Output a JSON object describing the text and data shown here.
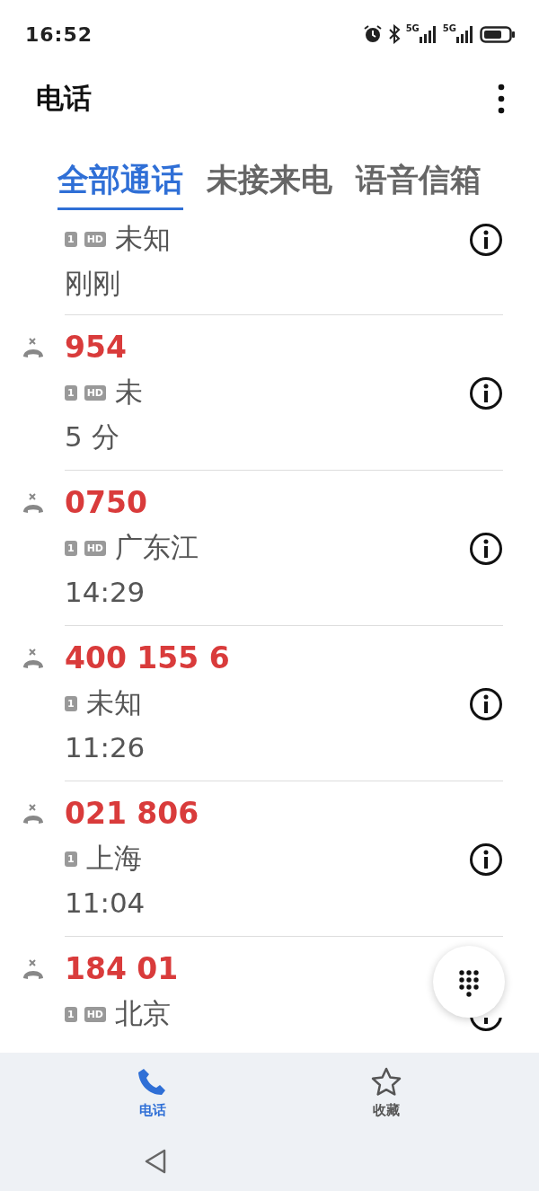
{
  "status_bar": {
    "time": "16:52",
    "network_labels": [
      "5G",
      "5G"
    ]
  },
  "header": {
    "title": "电话"
  },
  "tabs": [
    {
      "label": "全部通话",
      "selected": true
    },
    {
      "label": "未接来电",
      "selected": false
    },
    {
      "label": "语音信箱",
      "selected": false
    }
  ],
  "calls": [
    {
      "missed": false,
      "badges": [
        "1",
        "HD"
      ],
      "location": "未知",
      "time": "刚刚"
    },
    {
      "missed": true,
      "number": "954",
      "badges": [
        "1",
        "HD"
      ],
      "location": "未",
      "time": "5 分"
    },
    {
      "missed": true,
      "number": "0750",
      "badges": [
        "1",
        "HD"
      ],
      "location": "广东江",
      "time": "14:29"
    },
    {
      "missed": true,
      "number": "400 155 6",
      "badges": [
        "1"
      ],
      "location": "未知",
      "time": "11:26"
    },
    {
      "missed": true,
      "number": "021 806",
      "badges": [
        "1"
      ],
      "location": "上海",
      "time": "11:04"
    },
    {
      "missed": true,
      "number": "184 01",
      "badges": [
        "1",
        "HD"
      ],
      "location": "北京"
    }
  ],
  "bottom_nav": [
    {
      "label": "电话",
      "kind": "phone",
      "selected": true
    },
    {
      "label": "收藏",
      "kind": "star",
      "selected": false
    }
  ]
}
